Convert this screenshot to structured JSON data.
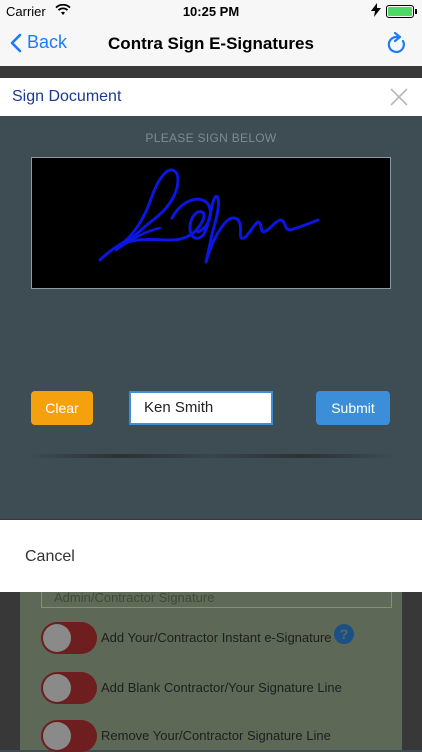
{
  "status_bar": {
    "carrier": "Carrier",
    "time": "10:25 PM"
  },
  "nav": {
    "back_label": "Back",
    "title": "Contra Sign E-Signatures"
  },
  "dialog": {
    "title": "Sign Document",
    "prompt": "PLEASE SIGN BELOW",
    "clear_label": "Clear",
    "name_value": "Ken Smith",
    "submit_label": "Submit"
  },
  "sheet": {
    "cancel_label": "Cancel"
  },
  "background_form": {
    "field_text": "Admin/Contractor Signature",
    "toggles": [
      {
        "label": "Add Your/Contractor Instant e-Signature"
      },
      {
        "label": "Add Blank Contractor/Your Signature Line"
      },
      {
        "label": "Remove Your/Contractor Signature Line"
      }
    ]
  },
  "colors": {
    "accent": "#1b7cf5",
    "clear": "#f5a10d",
    "submit": "#3c8ed8",
    "signature_ink": "#0a17e0"
  }
}
